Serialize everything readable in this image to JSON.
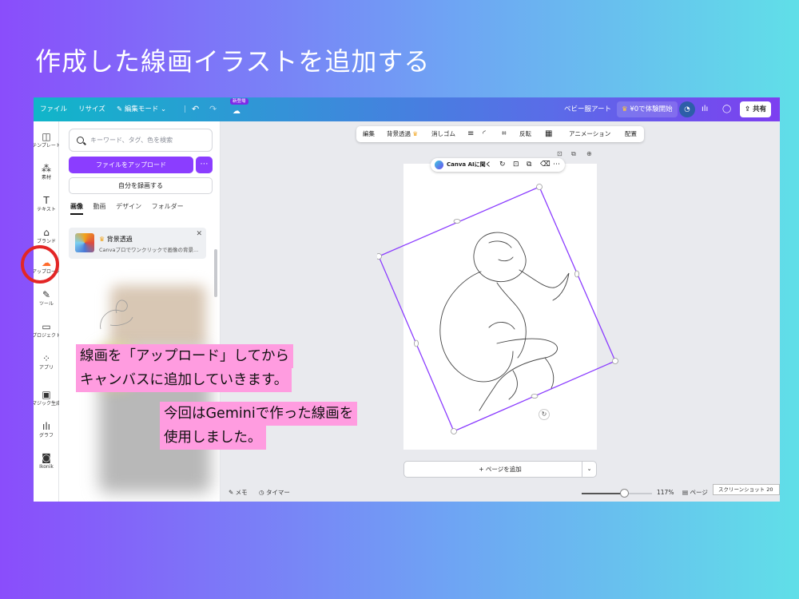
{
  "slide": {
    "title": "作成した線画イラストを追加する"
  },
  "topbar": {
    "file": "ファイル",
    "resize": "リサイズ",
    "edit_mode": "編集モード",
    "new_badge": "新登場",
    "design_name": "ベビー服アート",
    "trial": "¥0で体験開始",
    "share": "共有"
  },
  "rail": {
    "items": [
      {
        "label": "テンプレート",
        "icon": "template-icon"
      },
      {
        "label": "素材",
        "icon": "elements-icon"
      },
      {
        "label": "テキスト",
        "icon": "text-icon"
      },
      {
        "label": "ブランド",
        "icon": "brand-icon"
      },
      {
        "label": "アップロード",
        "icon": "upload-cloud-icon"
      },
      {
        "label": "ツール",
        "icon": "draw-icon"
      },
      {
        "label": "プロジェクト",
        "icon": "folder-icon"
      },
      {
        "label": "アプリ",
        "icon": "apps-icon"
      },
      {
        "label": "マジック生成",
        "icon": "magic-icon"
      },
      {
        "label": "グラフ",
        "icon": "chart-icon"
      },
      {
        "label": "Ikonik",
        "icon": "ikonik-icon"
      }
    ]
  },
  "panel": {
    "search_placeholder": "キーワード、タグ、色を検索",
    "upload_button": "ファイルをアップロード",
    "record_button": "自分を録画する",
    "tabs": [
      "画像",
      "動画",
      "デザイン",
      "フォルダー"
    ],
    "promo_title": "背景透過",
    "promo_body": "Canvaプロでワンクリックで画像の背景..."
  },
  "context_toolbar": {
    "edit": "編集",
    "bg_remove": "背景透過",
    "eraser": "消しゴム",
    "flip": "反転",
    "animation": "アニメーション",
    "position": "配置"
  },
  "ai_bar": {
    "label": "Canva AIに聞く"
  },
  "canvas": {
    "add_page": "+ ページを追加"
  },
  "bottombar": {
    "notes": "メモ",
    "timer": "タイマー",
    "zoom": "117%",
    "zoom_level": 0.6,
    "pages": "ページ",
    "screenshot_tag": "スクリーンショット 20"
  },
  "callouts": {
    "line1": "線画を「アップロード」してから",
    "line2": "キャンバスに追加していきます。",
    "line3": "今回はGeminiで作った線画を",
    "line4": "使用しました。"
  },
  "colors": {
    "accent_purple": "#8b3dff",
    "callout_pink": "#ff9ce0",
    "highlight_red": "#e32626",
    "upload_orange": "#ff6b2c"
  }
}
